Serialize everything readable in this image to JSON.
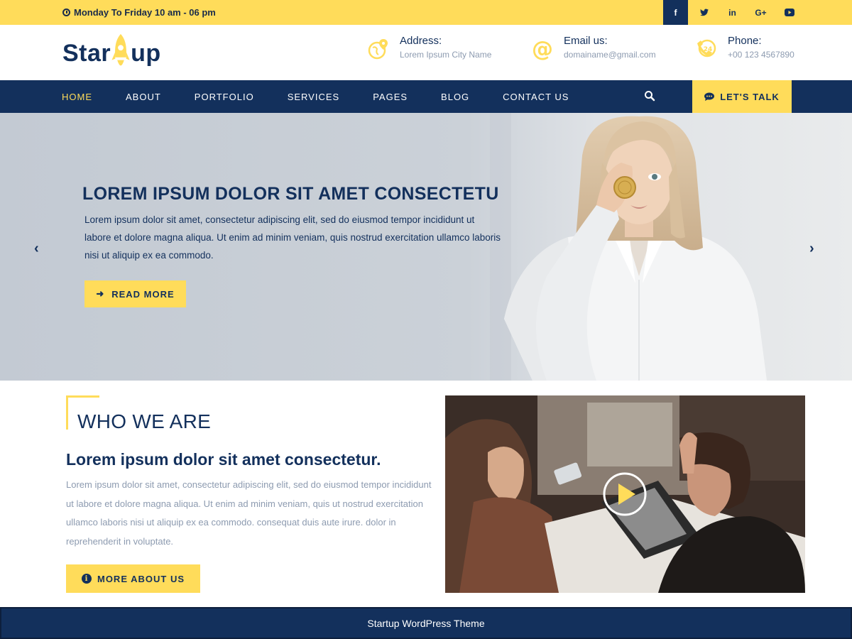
{
  "topbar": {
    "hours": "Monday To Friday  10 am - 06 pm",
    "social": [
      {
        "icon": "facebook-icon",
        "glyph": "f"
      },
      {
        "icon": "twitter-icon",
        "glyph": "t"
      },
      {
        "icon": "linkedin-icon",
        "glyph": "in"
      },
      {
        "icon": "google-plus-icon",
        "glyph": "G+"
      },
      {
        "icon": "youtube-icon",
        "glyph": "▶"
      }
    ]
  },
  "header": {
    "logo_left": "Star",
    "logo_right": "up",
    "address_label": "Address:",
    "address_value": "Lorem Ipsum City Name",
    "email_label": "Email us:",
    "email_value": "domainame@gmail.com",
    "phone_label": "Phone:",
    "phone_value": "+00 123 4567890"
  },
  "nav": {
    "items": [
      "HOME",
      "ABOUT",
      "PORTFOLIO",
      "SERVICES",
      "PAGES",
      "BLOG",
      "CONTACT US"
    ],
    "cta": "LET'S TALK"
  },
  "hero": {
    "title": "LOREM IPSUM DOLOR SIT AMET CONSECTETU",
    "text": "Lorem ipsum dolor sit amet, consectetur adipiscing elit, sed do eiusmod tempor incididunt ut labore et dolore magna aliqua. Ut enim ad minim veniam, quis nostrud exercitation ullamco laboris nisi ut aliquip ex ea commodo.",
    "button": "READ MORE"
  },
  "about": {
    "title": "WHO WE ARE",
    "subtitle": "Lorem ipsum dolor sit amet consectetur.",
    "text": "Lorem ipsum dolor sit amet, consectetur adipiscing elit, sed do eiusmod tempor incididunt ut labore et dolore magna aliqua. Ut enim ad minim veniam, quis ut nostrud exercitation ullamco laboris nisi ut aliquip ex ea commodo. consequat duis aute irure. dolor in reprehenderit in voluptate.",
    "button": "MORE ABOUT US"
  },
  "footer": {
    "text": "Startup WordPress Theme"
  },
  "colors": {
    "navy": "#13305c",
    "yellow": "#ffdc5a",
    "muted": "#8d9bb0"
  }
}
